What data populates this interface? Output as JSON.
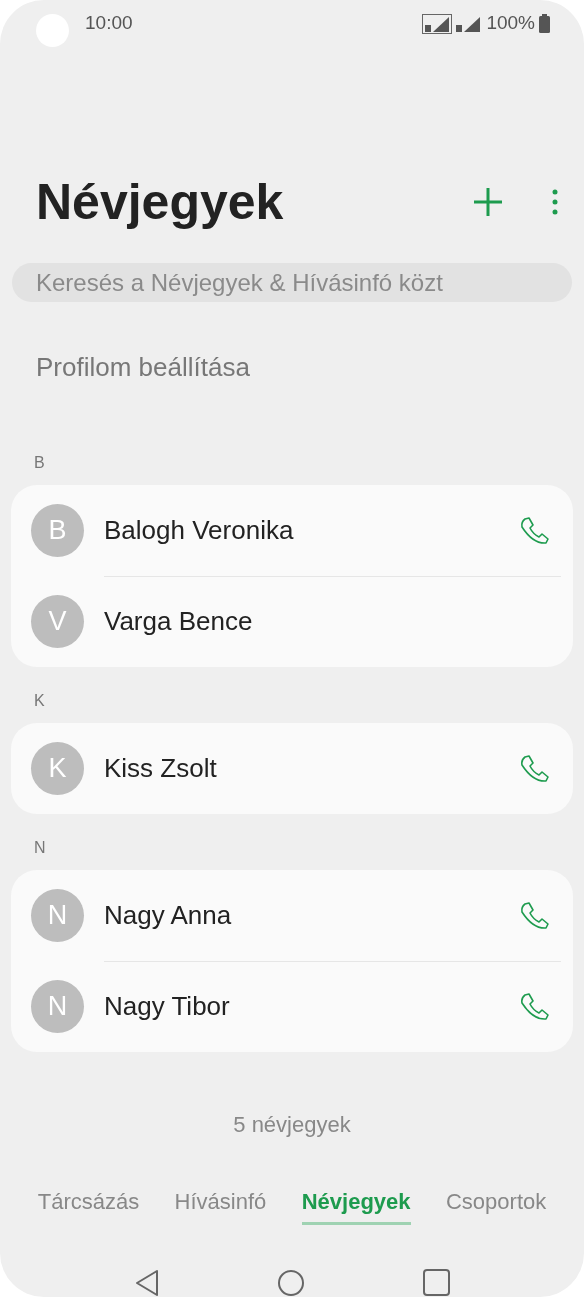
{
  "status_bar": {
    "time": "10:00",
    "battery": "100%"
  },
  "title": "Névjegyek",
  "search": {
    "placeholder": "Keresés a Névjegyek & Hívásinfó közt"
  },
  "profile_link": "Profilom beállítása",
  "sections": [
    {
      "letter": "B",
      "contacts": [
        {
          "initial": "B",
          "name": "Balogh Veronika",
          "has_call": true
        },
        {
          "initial": "V",
          "name": "Varga Bence",
          "has_call": false
        }
      ]
    },
    {
      "letter": "K",
      "contacts": [
        {
          "initial": "K",
          "name": "Kiss Zsolt",
          "has_call": true
        }
      ]
    },
    {
      "letter": "N",
      "contacts": [
        {
          "initial": "N",
          "name": "Nagy Anna",
          "has_call": true
        },
        {
          "initial": "N",
          "name": "Nagy Tibor",
          "has_call": true
        }
      ]
    }
  ],
  "count": "5 névjegyek",
  "tabs": [
    {
      "label": "Tárcsázás",
      "selected": false
    },
    {
      "label": "Hívásinfó",
      "selected": false
    },
    {
      "label": "Névjegyek",
      "selected": true
    },
    {
      "label": "Csoportok",
      "selected": false
    }
  ]
}
